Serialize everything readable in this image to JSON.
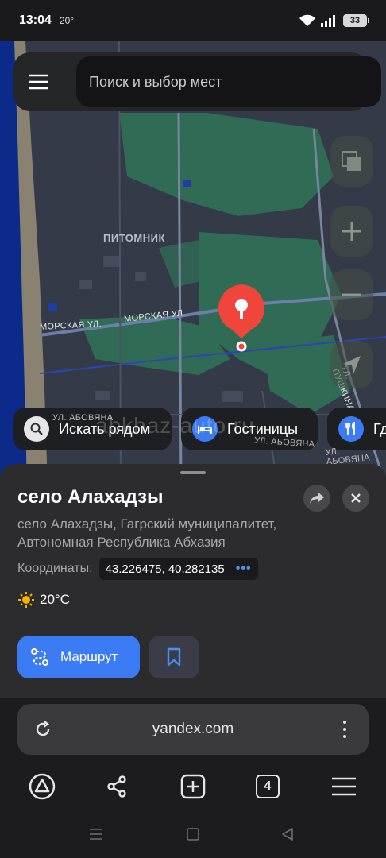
{
  "status_bar": {
    "time": "13:04",
    "temperature": "20°",
    "battery": "33"
  },
  "map": {
    "search_placeholder": "Поиск и выбор мест",
    "district_label": "ПИТОМНИК",
    "streets": {
      "morskaya_1": "МОРСКАЯ УЛ.",
      "morskaya_2": "МОРСКАЯ УЛ.",
      "pushkina": "УЛ. ПУШКИНА",
      "abovyana_1": "УЛ. АБОВЯНА",
      "abovyana_2": "УЛ. АБОВЯНА",
      "abovyana_3": "УЛ. АБОВЯНА"
    },
    "watermark": "abkhaz-auto.ru",
    "chips": [
      {
        "label": "Искать рядом",
        "icon": "search-icon"
      },
      {
        "label": "Гостиницы",
        "icon": "bed-icon"
      },
      {
        "label": "Где поесть",
        "icon": "fork-knife-icon"
      }
    ]
  },
  "place": {
    "title": "село Алахадзы",
    "address": "село Алахадзы, Гагрский муниципалитет, Автономная Республика Абхазия",
    "coords_label": "Координаты:",
    "coords_value": "43.226475, 40.282135",
    "coords_more": "•••",
    "weather": "20°C",
    "route_label": "Маршрут"
  },
  "browser": {
    "url": "yandex.com",
    "tabs_count": "4"
  },
  "colors": {
    "accent": "#3b7cf5",
    "pin": "#f0453a",
    "map_green": "#2f6b55",
    "sea": "#0b2a8a"
  }
}
